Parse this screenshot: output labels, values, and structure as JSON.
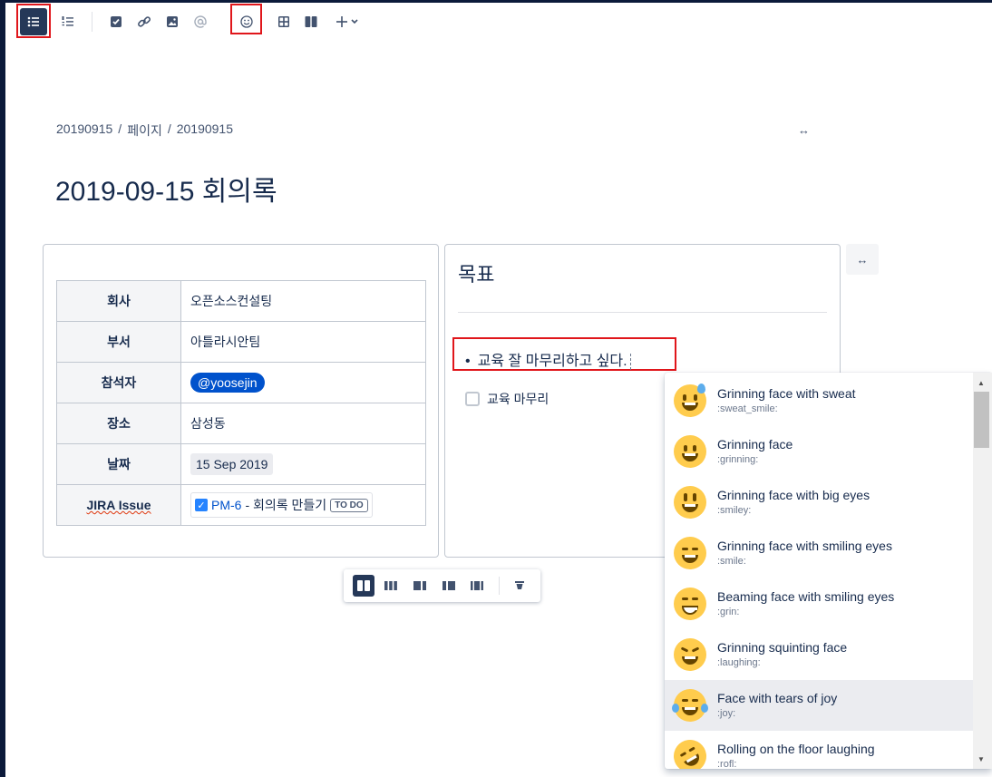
{
  "toolbar": {
    "buttons": [
      {
        "name": "bullet-list-icon"
      },
      {
        "name": "numbered-list-icon"
      },
      {
        "name": "task-checkbox-icon"
      },
      {
        "name": "link-icon"
      },
      {
        "name": "image-icon"
      },
      {
        "name": "mention-icon"
      },
      {
        "name": "emoji-icon"
      },
      {
        "name": "table-icon"
      },
      {
        "name": "layout-icon"
      },
      {
        "name": "insert-more-icon"
      }
    ],
    "insert_label": "+"
  },
  "breadcrumb": {
    "items": [
      "20190915",
      "페이지",
      "20190915"
    ],
    "separator": "/"
  },
  "expand_label": "↔",
  "page": {
    "title": "2019-09-15 회의록"
  },
  "info_table": {
    "rows": [
      {
        "key": "회사",
        "value": "오픈소스컨설팅"
      },
      {
        "key": "부서",
        "value": "아틀라시안팀"
      },
      {
        "key": "참석자",
        "value": "@yoosejin"
      },
      {
        "key": "장소",
        "value": "삼성동"
      },
      {
        "key": "날짜",
        "value": "15 Sep 2019"
      },
      {
        "key": "JIRA Issue",
        "jira_key": "PM-6",
        "jira_summary": "- 회의록 만들기",
        "jira_status": "TO DO"
      }
    ]
  },
  "goal": {
    "heading": "목표",
    "bullet": "교육 잘 마무리하고 싶다.",
    "task": "교육 마무리"
  },
  "emoji_picker": {
    "items": [
      {
        "name": "Grinning face with sweat",
        "code": ":sweat_smile:"
      },
      {
        "name": "Grinning face",
        "code": ":grinning:"
      },
      {
        "name": "Grinning face with big eyes",
        "code": ":smiley:"
      },
      {
        "name": "Grinning face with smiling eyes",
        "code": ":smile:"
      },
      {
        "name": "Beaming face with smiling eyes",
        "code": ":grin:"
      },
      {
        "name": "Grinning squinting face",
        "code": ":laughing:"
      },
      {
        "name": "Face with tears of joy",
        "code": ":joy:",
        "selected": true
      },
      {
        "name": "Rolling on the floor laughing",
        "code": ":rofl:"
      }
    ]
  },
  "colors": {
    "highlight": "#e0161b",
    "mention_bg": "#0052cc",
    "toolbar_active": "#253858"
  }
}
